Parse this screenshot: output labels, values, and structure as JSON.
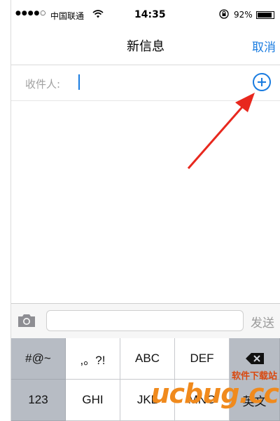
{
  "status_bar": {
    "signal": "●●●●○",
    "carrier": "中国联通",
    "wifi_icon": "wifi-icon",
    "time": "14:35",
    "lock_icon": "rotation-lock-icon",
    "battery_percent": "92%",
    "battery_level": 0.92
  },
  "nav": {
    "title": "新信息",
    "cancel_label": "取消"
  },
  "recipient": {
    "label": "收件人:",
    "value": "",
    "add_icon": "plus-circle-icon"
  },
  "compose": {
    "camera_icon": "camera-icon",
    "message_value": "",
    "send_label": "发送"
  },
  "keyboard": {
    "row1": [
      "#@~",
      ",。?!",
      "ABC",
      "DEF"
    ],
    "backspace_icon": "backspace-icon",
    "row2": [
      "123",
      "GHI",
      "JKL",
      "MNO"
    ],
    "lang_key": "英文"
  },
  "watermark": {
    "top_text": "软件下载站",
    "logo_text": "ucbug.cc"
  },
  "colors": {
    "accent": "#1a7ce0",
    "annotation_arrow": "#e8281e"
  }
}
